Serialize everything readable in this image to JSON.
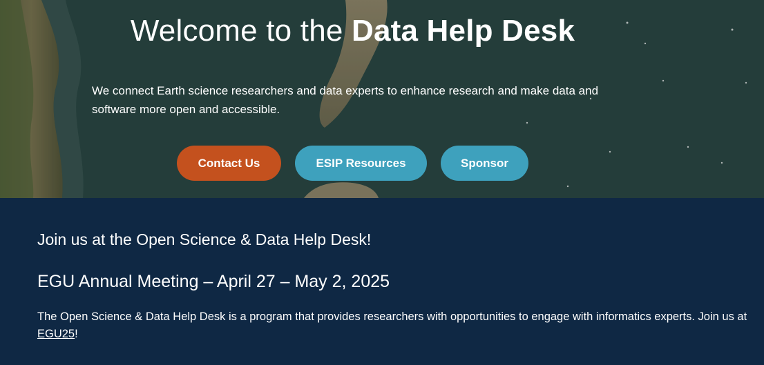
{
  "hero": {
    "title_prefix": "Welcome to the ",
    "title_strong": "Data Help Desk",
    "description": "We connect Earth science researchers and data experts to enhance research and make data and software more open and accessible.",
    "buttons": {
      "contact_label": "Contact Us",
      "esip_label": "ESIP Resources",
      "sponsor_label": "Sponsor"
    },
    "background_image": "aerial-coastline-image"
  },
  "content": {
    "join_heading": "Join us at the Open Science & Data Help Desk!",
    "event_heading": "EGU Annual Meeting – April 27 – May 2, 2025",
    "paragraph_text": "The Open Science & Data Help Desk is a program that provides researchers with opportunities to engage with informatics experts. Join us at ",
    "paragraph_link": "EGU25",
    "paragraph_end": "!"
  },
  "colors": {
    "contact_button": "#c4511e",
    "secondary_button": "#3ea1bd",
    "content_background": "#0f2844"
  }
}
